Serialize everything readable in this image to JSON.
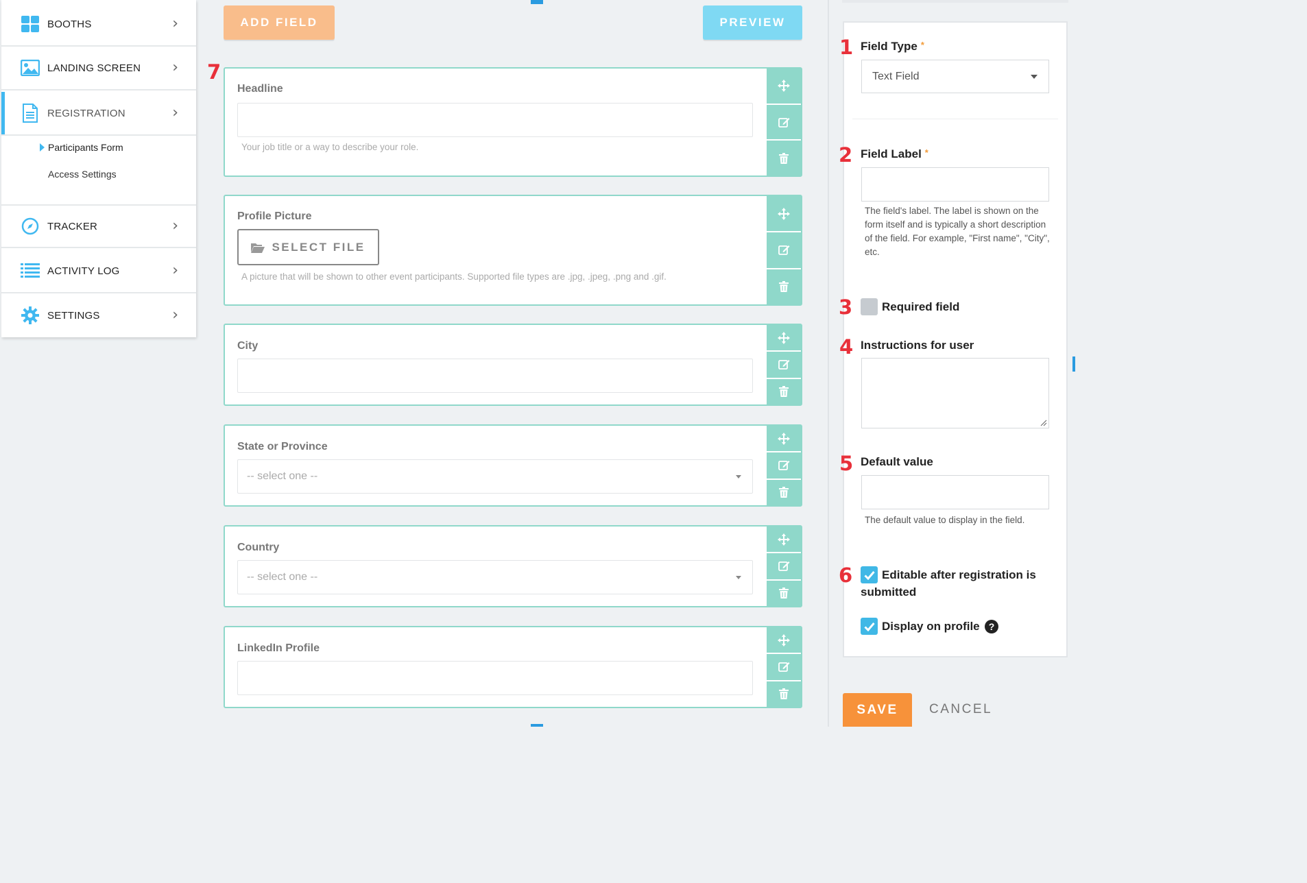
{
  "sidebar": {
    "items": [
      {
        "label": "BOOTHS",
        "icon": "booths-grid-icon"
      },
      {
        "label": "LANDING SCREEN",
        "icon": "landing-image-icon"
      },
      {
        "label": "REGISTRATION",
        "icon": "registration-document-icon"
      },
      {
        "label": "TRACKER",
        "icon": "tracker-compass-icon"
      },
      {
        "label": "ACTIVITY LOG",
        "icon": "activity-list-icon"
      },
      {
        "label": "SETTINGS",
        "icon": "settings-gear-icon"
      }
    ],
    "sub_items": [
      {
        "label": "Participants Form"
      },
      {
        "label": "Access Settings"
      }
    ]
  },
  "toolbar": {
    "add_field_label": "ADD FIELD",
    "preview_label": "PREVIEW"
  },
  "fields": [
    {
      "label": "Headline",
      "help": "Your job title or a way to describe your role."
    },
    {
      "label": "Profile Picture",
      "button": "SELECT FILE",
      "help": "A picture that will be shown to other event participants. Supported file types are .jpg, .jpeg, .png and .gif."
    },
    {
      "label": "City"
    },
    {
      "label": "State or Province",
      "placeholder": "-- select one --"
    },
    {
      "label": "Country",
      "placeholder": "-- select one --"
    },
    {
      "label": "LinkedIn Profile"
    }
  ],
  "annotations": [
    "1",
    "2",
    "3",
    "4",
    "5",
    "6",
    "7"
  ],
  "panel": {
    "field_type_label": "Field Type",
    "field_type_value": "Text Field",
    "required_star": "*",
    "field_label_label": "Field Label",
    "field_label_help": "The field's label. The label is shown on the form itself and is typically a short description of the field. For example, \"First name\", \"City\", etc.",
    "required_field_label": "Required field",
    "instructions_label": "Instructions for user",
    "default_value_label": "Default value",
    "default_value_help": "The default value to display in the field.",
    "editable_label": "Editable after registration is submitted",
    "display_profile_label": "Display on profile",
    "help_glyph": "?",
    "required_checked": false,
    "editable_checked": true,
    "display_checked": true
  },
  "footer": {
    "save_label": "SAVE",
    "cancel_label": "CANCEL"
  },
  "colors": {
    "accent_blue": "#40b8f0",
    "card_border": "#8fd8ca",
    "add_field_bg": "#f9bd8b",
    "preview_bg": "#7fd9f3",
    "save_bg": "#f7923a",
    "annotation_red": "#e8303a"
  }
}
